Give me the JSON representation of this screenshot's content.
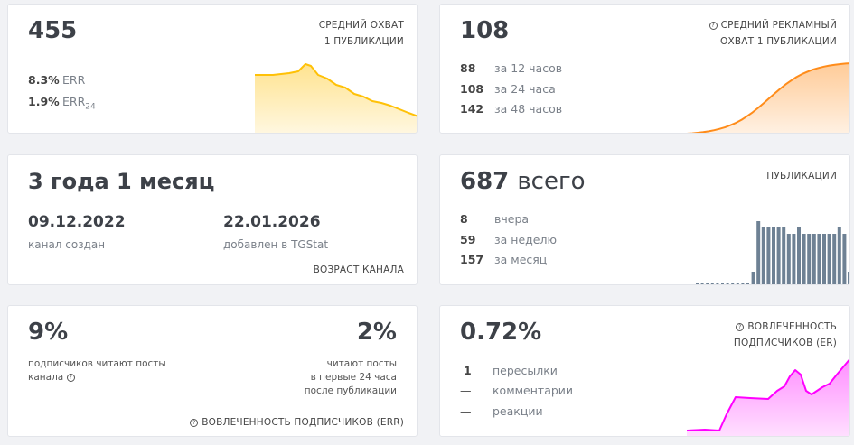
{
  "reach": {
    "value": "455",
    "label_line1": "СРЕДНИЙ ОХВАТ",
    "label_line2": "1 ПУБЛИКАЦИИ",
    "err_value": "8.3%",
    "err_label": "ERR",
    "err24_value": "1.9%",
    "err24_label": "ERR",
    "err24_sub": "24",
    "color": "#ffc107"
  },
  "ad_reach": {
    "value": "108",
    "label_line1": "СРЕДНИЙ РЕКЛАМНЫЙ",
    "label_line2": "ОХВАТ 1 ПУБЛИКАЦИИ",
    "rows": [
      {
        "v": "88",
        "t": "за 12 часов"
      },
      {
        "v": "108",
        "t": "за 24 часа"
      },
      {
        "v": "142",
        "t": "за 48 часов"
      }
    ],
    "color": "#ff8c1a"
  },
  "age": {
    "value": "3 года 1 месяц",
    "created_date": "09.12.2022",
    "created_label": "канал создан",
    "added_date": "22.01.2026",
    "added_label": "добавлен в TGStat",
    "label": "ВОЗРАСТ КАНАЛА"
  },
  "posts": {
    "value": "687",
    "value_suffix": "всего",
    "label": "ПУБЛИКАЦИИ",
    "rows": [
      {
        "v": "8",
        "t": "вчера"
      },
      {
        "v": "59",
        "t": "за неделю"
      },
      {
        "v": "157",
        "t": "за месяц"
      }
    ],
    "daily": [
      0,
      0,
      0,
      0,
      0,
      0,
      0,
      0,
      0,
      0,
      0,
      2,
      10,
      9,
      9,
      9,
      9,
      9,
      8,
      8,
      9,
      8,
      8,
      8,
      8,
      8,
      8,
      8,
      9,
      8,
      2
    ],
    "color": "#6e8194"
  },
  "err": {
    "left_value": "9%",
    "left_text1": "подписчиков читают посты",
    "left_text2": "канала",
    "right_value": "2%",
    "right_text1": "читают посты",
    "right_text2": "в первые 24 часа",
    "right_text3": "после публикации",
    "label": "ВОВЛЕЧЕННОСТЬ ПОДПИСЧИКОВ (ERR)"
  },
  "er": {
    "value": "0.72%",
    "label_line1": "ВОВЛЕЧЕННОСТЬ",
    "label_line2": "ПОДПИСЧИКОВ (ER)",
    "rows": [
      {
        "v": "1",
        "t": "пересылки"
      },
      {
        "v": "—",
        "t": "комментарии"
      },
      {
        "v": "—",
        "t": "реакции"
      }
    ],
    "color": "#ff00ff"
  }
}
